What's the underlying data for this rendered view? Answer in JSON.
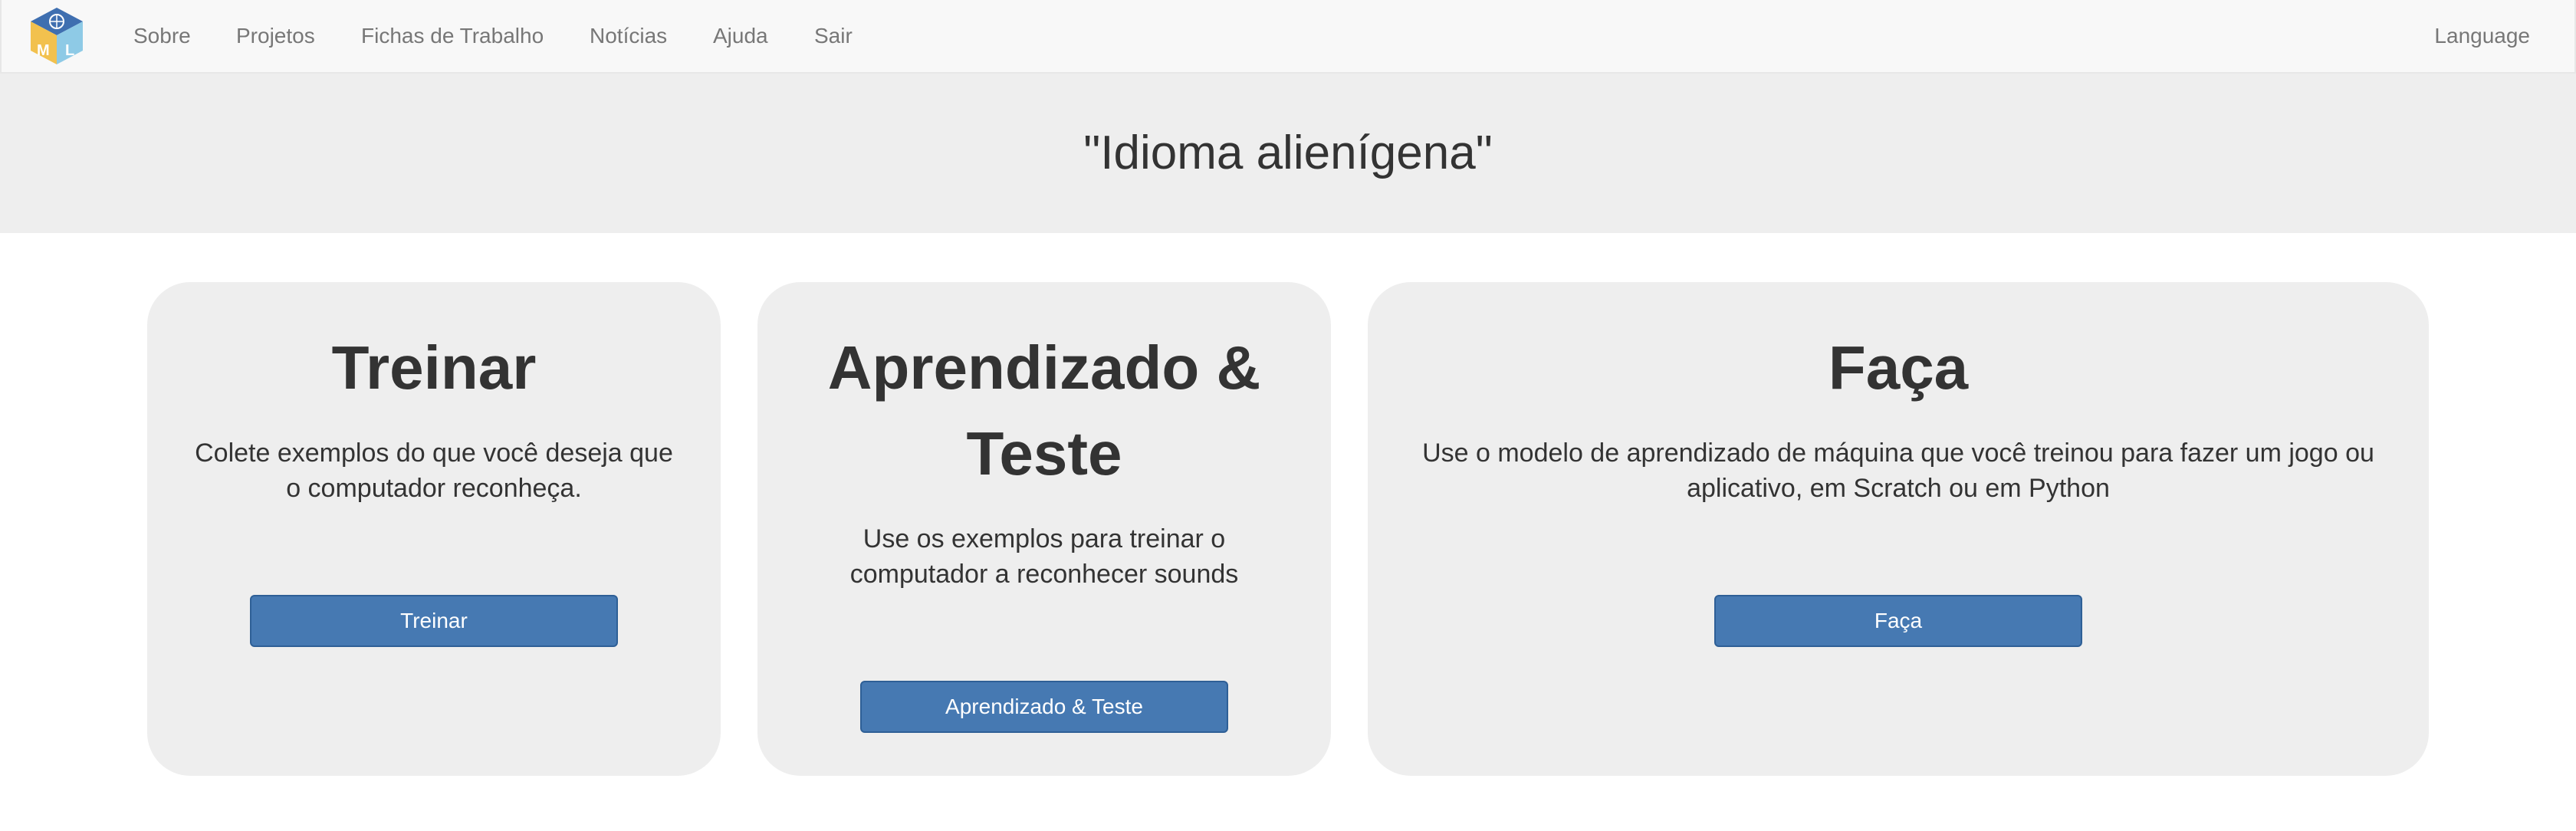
{
  "nav": {
    "items": [
      {
        "label": "Sobre"
      },
      {
        "label": "Projetos"
      },
      {
        "label": "Fichas de Trabalho"
      },
      {
        "label": "Notícias"
      },
      {
        "label": "Ajuda"
      },
      {
        "label": "Sair"
      }
    ],
    "language_label": "Language",
    "logo_icon": "ml-cube-logo-icon"
  },
  "header": {
    "title": "\"Idioma alienígena\""
  },
  "cards": [
    {
      "title": "Treinar",
      "description": "Colete exemplos do que você deseja que o computador reconheça.",
      "button_label": "Treinar"
    },
    {
      "title": "Aprendizado & Teste",
      "description": "Use os exemplos para treinar o computador a reconhecer sounds",
      "button_label": "Aprendizado & Teste"
    },
    {
      "title": "Faça",
      "description": "Use o modelo de aprendizado de máquina que você treinou para fazer um jogo ou aplicativo, em Scratch ou em Python",
      "button_label": "Faça"
    }
  ],
  "colors": {
    "navbar_bg": "#f8f8f8",
    "band_bg": "#eeeeee",
    "button_bg": "#4679b2",
    "nav_text": "#777777"
  }
}
